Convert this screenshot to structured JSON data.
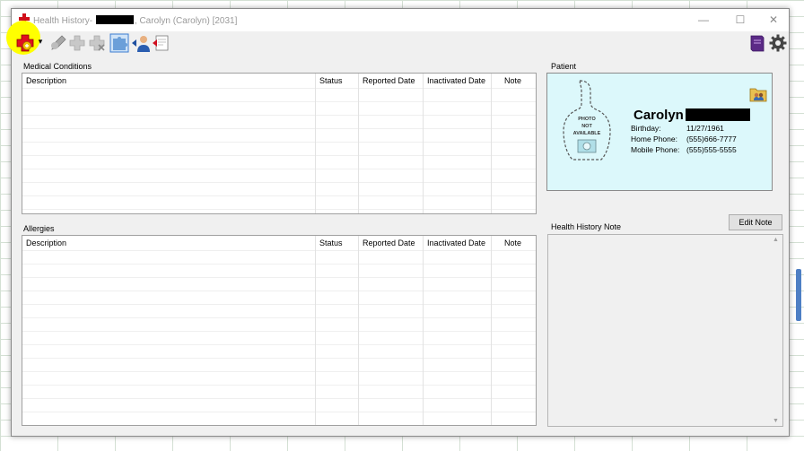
{
  "window": {
    "title_prefix": "Health History- ",
    "title_suffix": ", Carolyn (Carolyn) [2031]",
    "minimize_glyph": "—",
    "maximize_glyph": "☐",
    "close_glyph": "✕"
  },
  "toolbar": {
    "icons": [
      "add-condition-icon",
      "dropdown-arrow-icon",
      "edit-icon",
      "add-disabled-icon",
      "remove-disabled-icon",
      "puzzle-icon",
      "patient-icon",
      "report-icon",
      "book-icon",
      "gear-icon"
    ],
    "dropdown_glyph": "▾",
    "highlight_color": "#ffff00"
  },
  "medical_conditions": {
    "label": "Medical Conditions",
    "columns": [
      "Description",
      "Status",
      "Reported Date",
      "Inactivated Date",
      "Note"
    ],
    "rows": []
  },
  "allergies": {
    "label": "Allergies",
    "columns": [
      "Description",
      "Status",
      "Reported Date",
      "Inactivated Date",
      "Note"
    ],
    "rows": []
  },
  "patient": {
    "label": "Patient",
    "first_name": "Carolyn",
    "photo_text": [
      "PHOTO",
      "NOT",
      "AVAILABLE"
    ],
    "fields": [
      {
        "label": "Birthday:",
        "value": "11/27/1961"
      },
      {
        "label": "Home Phone:",
        "value": "(555)666-7777"
      },
      {
        "label": "Mobile Phone:",
        "value": "(555)555-5555"
      }
    ],
    "box_color": "#dcf8fb"
  },
  "health_history_note": {
    "label": "Health History Note",
    "edit_button": "Edit Note",
    "scroll_up": "▲",
    "scroll_down": "▼",
    "text": ""
  }
}
